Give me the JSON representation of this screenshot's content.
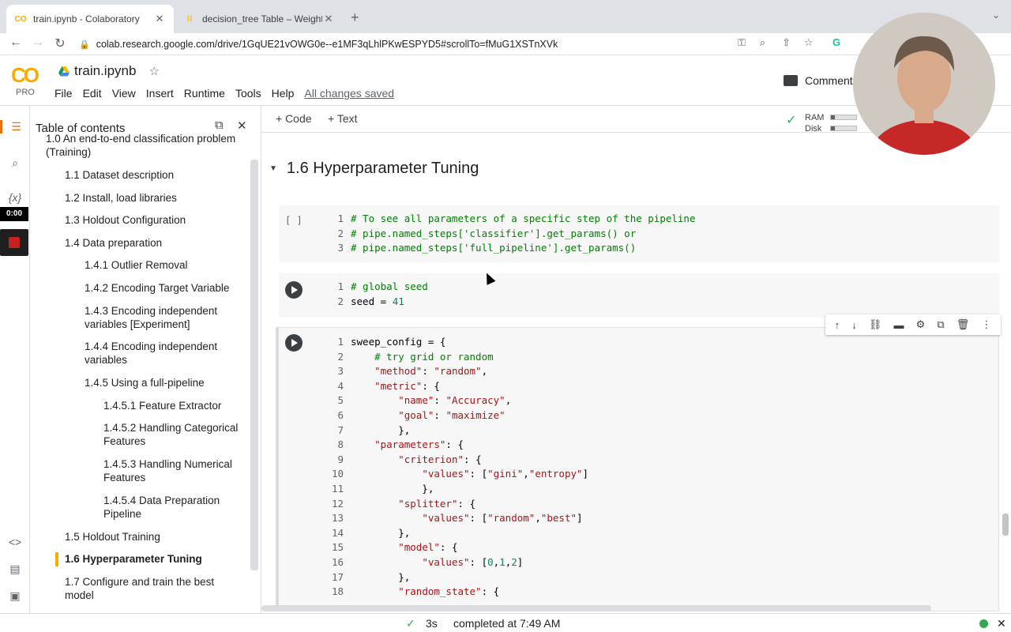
{
  "browser": {
    "tabs": [
      {
        "title": "train.ipynb - Colaboratory",
        "favicon": "CO"
      },
      {
        "title": "decision_tree Table – Weights",
        "favicon": "W"
      }
    ],
    "url": "colab.research.google.com/drive/1GqUE21vOWG0e--e1MF3qLhlPKwESPYD5#scrollTo=fMuG1XSTnXVk"
  },
  "colab": {
    "logo": "CO",
    "plan": "PRO",
    "notebook_title": "train.ipynb",
    "menu": [
      "File",
      "Edit",
      "View",
      "Insert",
      "Runtime",
      "Tools",
      "Help"
    ],
    "save_status": "All changes saved",
    "comment_label": "Comment",
    "add_code": "+ Code",
    "add_text": "+ Text",
    "ram_label": "RAM",
    "disk_label": "Disk",
    "ram_usage": 0.15,
    "disk_usage": 0.15
  },
  "recorder": {
    "timer": "0:00"
  },
  "toc": {
    "title": "Table of contents",
    "items": [
      {
        "text": "1.0 An end-to-end classification problem (Training)",
        "level": 1
      },
      {
        "text": "1.1 Dataset description",
        "level": 2
      },
      {
        "text": "1.2 Install, load libraries",
        "level": 2
      },
      {
        "text": "1.3 Holdout Configuration",
        "level": 2
      },
      {
        "text": "1.4 Data preparation",
        "level": 2
      },
      {
        "text": "1.4.1 Outlier Removal",
        "level": 3
      },
      {
        "text": "1.4.2 Encoding Target Variable",
        "level": 3
      },
      {
        "text": "1.4.3 Encoding independent variables [Experiment]",
        "level": 3
      },
      {
        "text": "1.4.4 Encoding independent variables",
        "level": 3
      },
      {
        "text": "1.4.5 Using a full-pipeline",
        "level": 3
      },
      {
        "text": "1.4.5.1 Feature Extractor",
        "level": 4
      },
      {
        "text": "1.4.5.2 Handling Categorical Features",
        "level": 4
      },
      {
        "text": "1.4.5.3 Handling Numerical Features",
        "level": 4
      },
      {
        "text": "1.4.5.4 Data Preparation Pipeline",
        "level": 4
      },
      {
        "text": "1.5 Holdout Training",
        "level": 2
      },
      {
        "text": "1.6 Hyperparameter Tuning",
        "level": 2,
        "current": true
      },
      {
        "text": "1.7 Configure and train the best model",
        "level": 2
      }
    ]
  },
  "notebook": {
    "section_title": "1.6 Hyperparameter Tuning",
    "cell1_bracket": "[ ]",
    "cells": [
      [
        "# To see all parameters of a specific step of the pipeline",
        "# pipe.named_steps['classifier'].get_params() or",
        "# pipe.named_steps['full_pipeline'].get_params()"
      ],
      [
        "# global seed",
        "seed = 41"
      ],
      [
        "sweep_config = {",
        "    # try grid or random",
        "    \"method\": \"random\",",
        "    \"metric\": {",
        "        \"name\": \"Accuracy\",",
        "        \"goal\": \"maximize\"",
        "        },",
        "    \"parameters\": {",
        "        \"criterion\": {",
        "            \"values\": [\"gini\",\"entropy\"]",
        "            },",
        "        \"splitter\": {",
        "            \"values\": [\"random\",\"best\"]",
        "        },",
        "        \"model\": {",
        "            \"values\": [0,1,2]",
        "        },",
        "        \"random_state\": {"
      ]
    ]
  },
  "status": {
    "check": "✓",
    "duration": "3s",
    "message": "completed at 7:49 AM"
  },
  "colors": {
    "accent": "#f9ab00",
    "toc_marker": "#f9ab00",
    "ok": "#34a853"
  }
}
